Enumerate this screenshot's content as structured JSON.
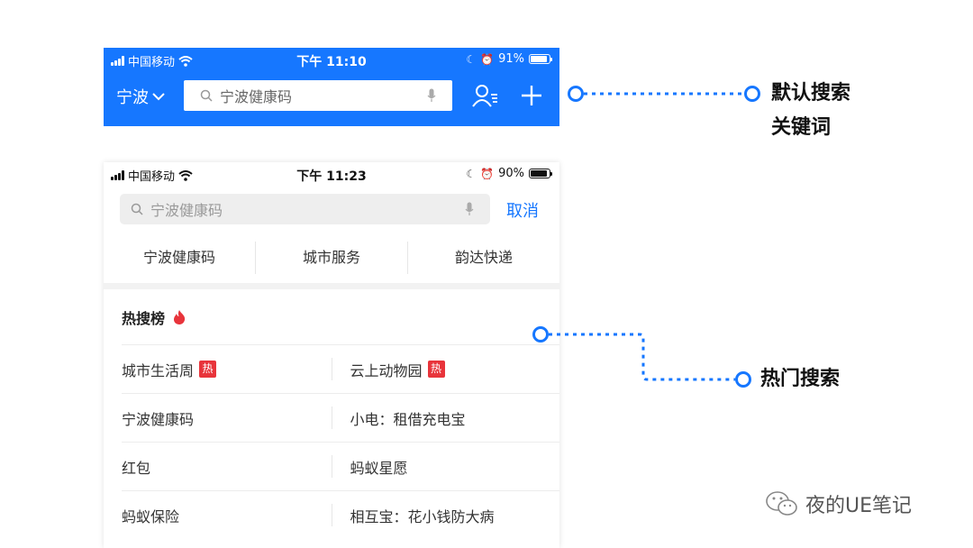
{
  "colors": {
    "accent": "#1677ff",
    "hot_tag": "#e8343b",
    "annotation_line": "#1677ff"
  },
  "phone_top": {
    "status_bar": {
      "carrier": "中国移动",
      "time": "下午 11:10",
      "battery": "91%",
      "battery_level": 0.91
    },
    "city": "宁波",
    "search_placeholder": "宁波健康码"
  },
  "phone_search": {
    "status_bar": {
      "carrier": "中国移动",
      "time": "下午 11:23",
      "battery": "90%",
      "battery_level": 0.9
    },
    "search_placeholder": "宁波健康码",
    "cancel_label": "取消",
    "quick_terms": [
      "宁波健康码",
      "城市服务",
      "韵达快递"
    ],
    "hot_title": "热搜榜",
    "hot_tag_label": "热",
    "hot_items": [
      {
        "left": "城市生活周",
        "left_hot": true,
        "right": "云上动物园",
        "right_hot": true
      },
      {
        "left": "宁波健康码",
        "left_hot": false,
        "right": "小电：租借充电宝",
        "right_hot": false
      },
      {
        "left": "红包",
        "left_hot": false,
        "right": "蚂蚁星愿",
        "right_hot": false
      },
      {
        "left": "蚂蚁保险",
        "left_hot": false,
        "right": "相互宝：花小钱防大病",
        "right_hot": false
      }
    ]
  },
  "annotations": {
    "default_keyword_line1": "默认搜索",
    "default_keyword_line2": "关键词",
    "hot_search": "热门搜索"
  },
  "watermark": "夜的UE笔记"
}
